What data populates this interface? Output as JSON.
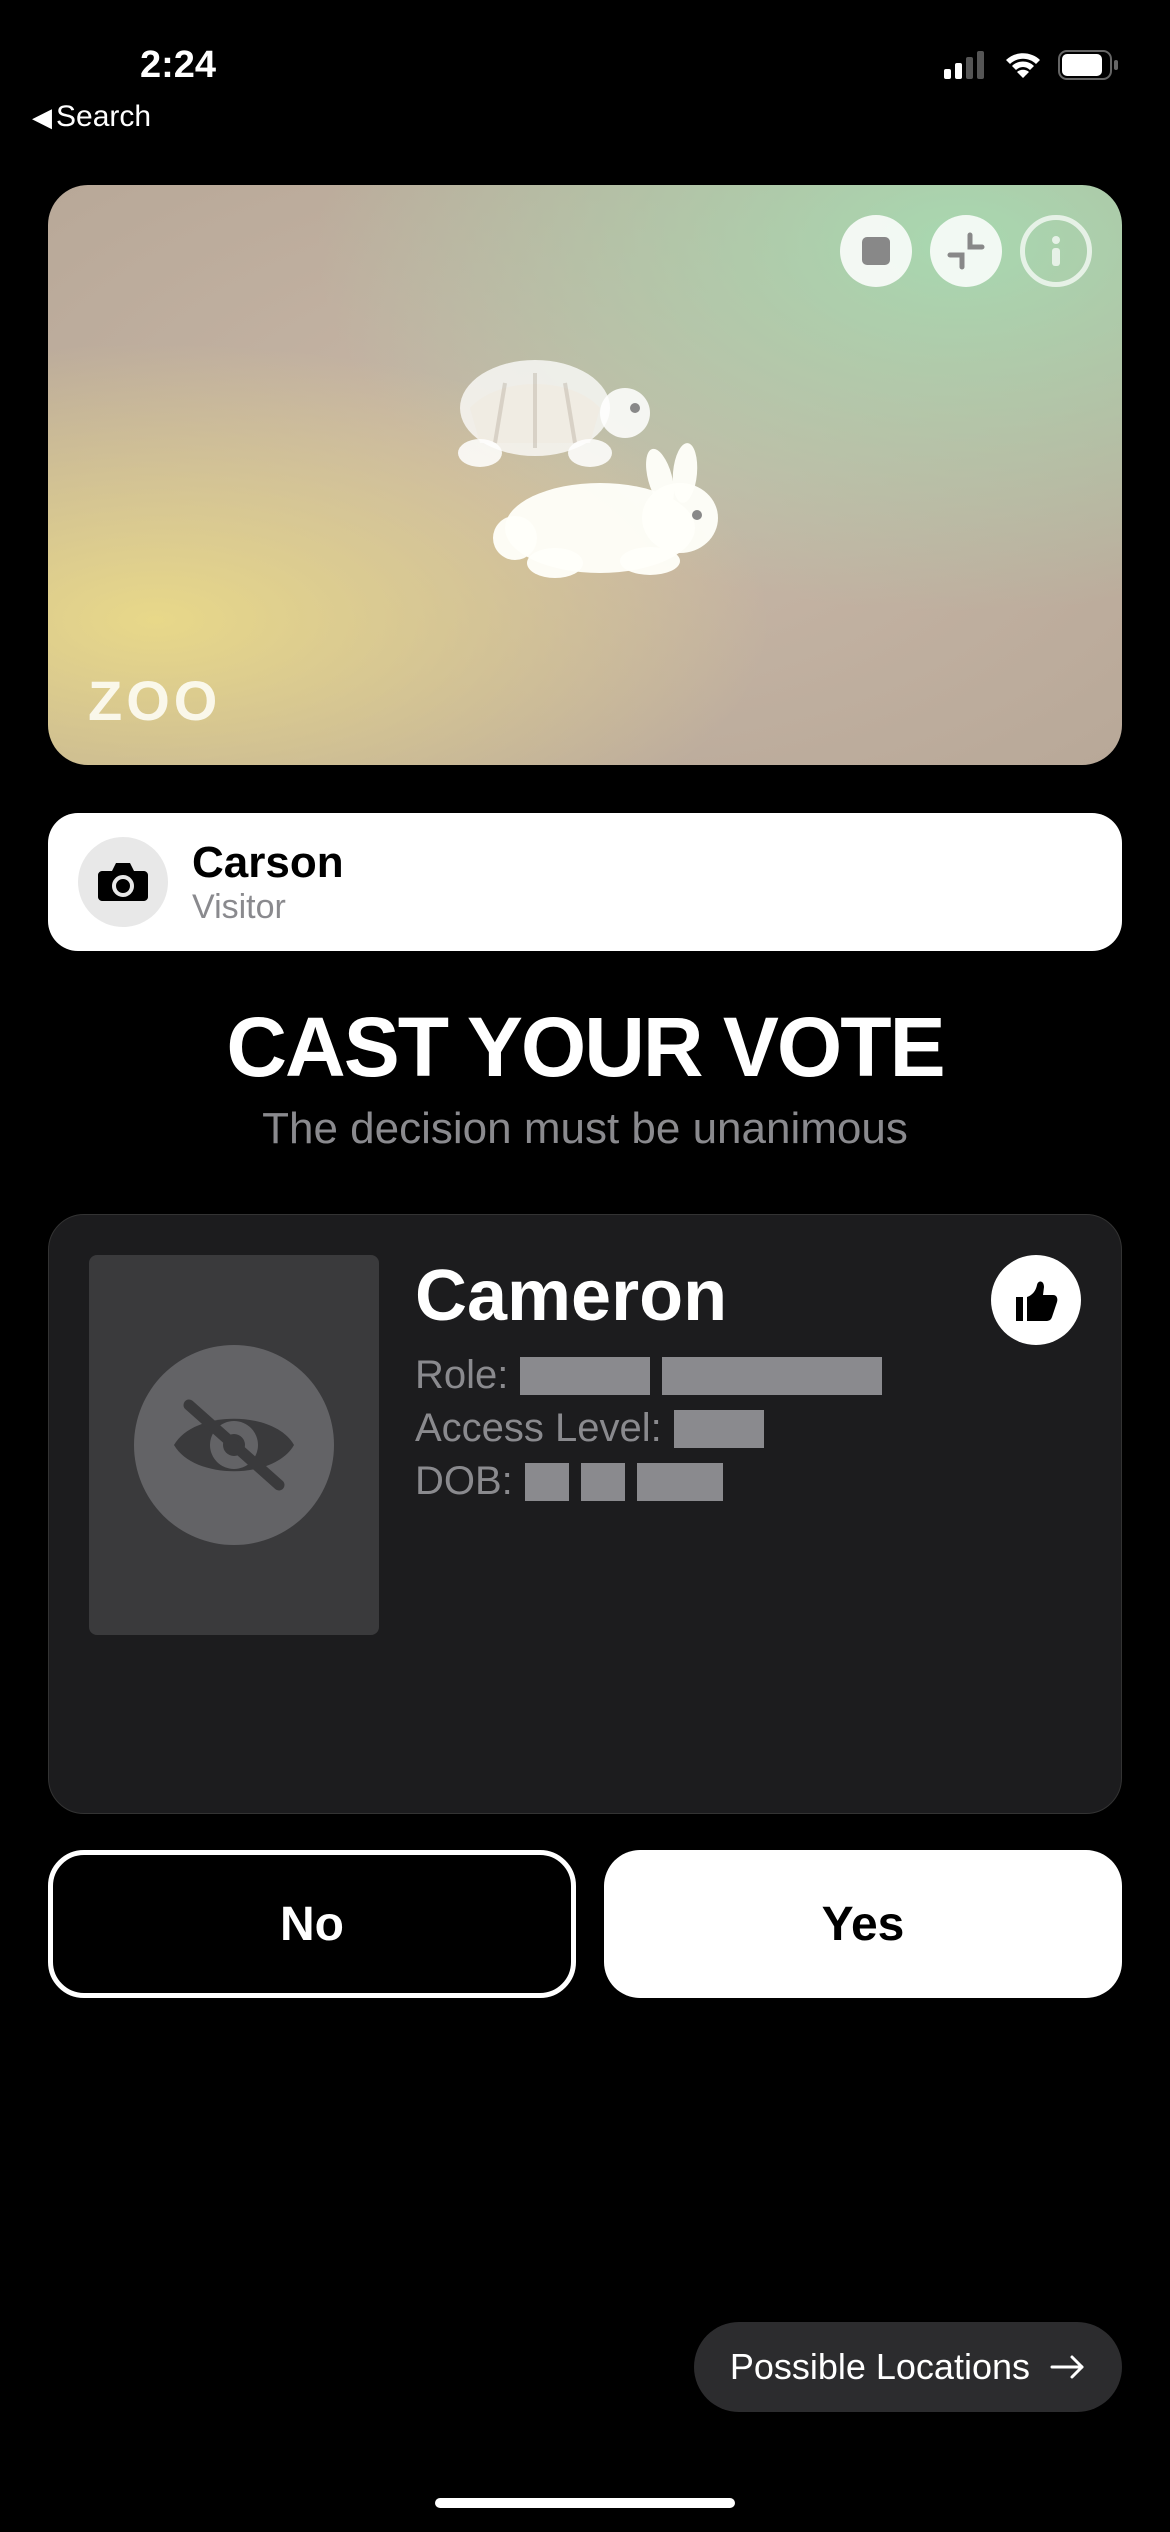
{
  "statusBar": {
    "time": "2:24",
    "backLabel": "Search"
  },
  "zooCard": {
    "label": "ZOO"
  },
  "player": {
    "name": "Carson",
    "role": "Visitor"
  },
  "heading": {
    "title": "CAST YOUR VOTE",
    "subtitle": "The decision must be unanimous"
  },
  "voteTarget": {
    "name": "Cameron",
    "roleLabel": "Role:",
    "accessLabel": "Access Level:",
    "dobLabel": "DOB:"
  },
  "buttons": {
    "no": "No",
    "yes": "Yes"
  },
  "locationsPill": "Possible Locations"
}
